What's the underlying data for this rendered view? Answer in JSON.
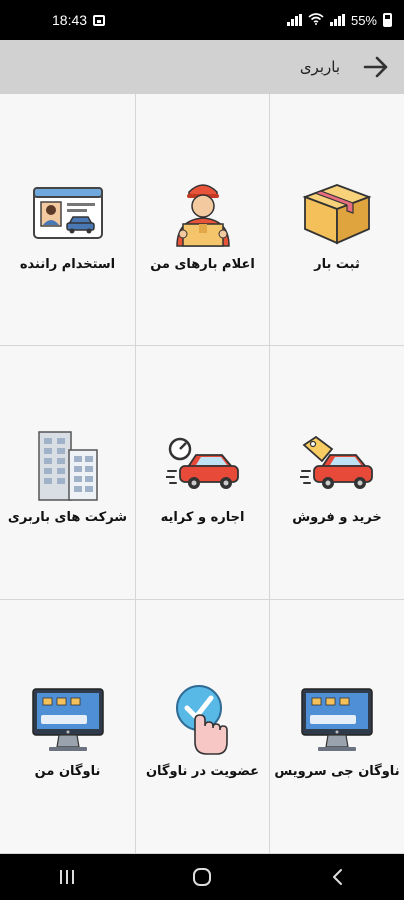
{
  "status_bar": {
    "time": "18:43",
    "battery_text": "55%",
    "icons": [
      "gallery-icon",
      "wifi-icon",
      "signal-icon",
      "battery-icon"
    ]
  },
  "app_bar": {
    "title": "باربری",
    "back_icon": "arrow-right-icon",
    "background": "#d1d1d1"
  },
  "grid": {
    "items": [
      {
        "label": "استخدام راننده",
        "icon": "driver-license-icon"
      },
      {
        "label": "اعلام بارهای من",
        "icon": "courier-icon"
      },
      {
        "label": "ثبت بار",
        "icon": "package-box-icon"
      },
      {
        "label": "شرکت های باربری",
        "icon": "building-icon"
      },
      {
        "label": "اجاره و کرایه",
        "icon": "car-rental-icon"
      },
      {
        "label": "خرید و فروش",
        "icon": "car-sale-icon"
      },
      {
        "label": "ناوگان من",
        "icon": "monitor-fleet-icon"
      },
      {
        "label": "عضویت در ناوگان",
        "icon": "touch-check-icon"
      },
      {
        "label": "ناوگان جی سرویس",
        "icon": "monitor-fleet-icon"
      }
    ]
  },
  "nav_bar": {
    "icons": [
      "recents-icon",
      "home-icon",
      "back-icon"
    ]
  }
}
